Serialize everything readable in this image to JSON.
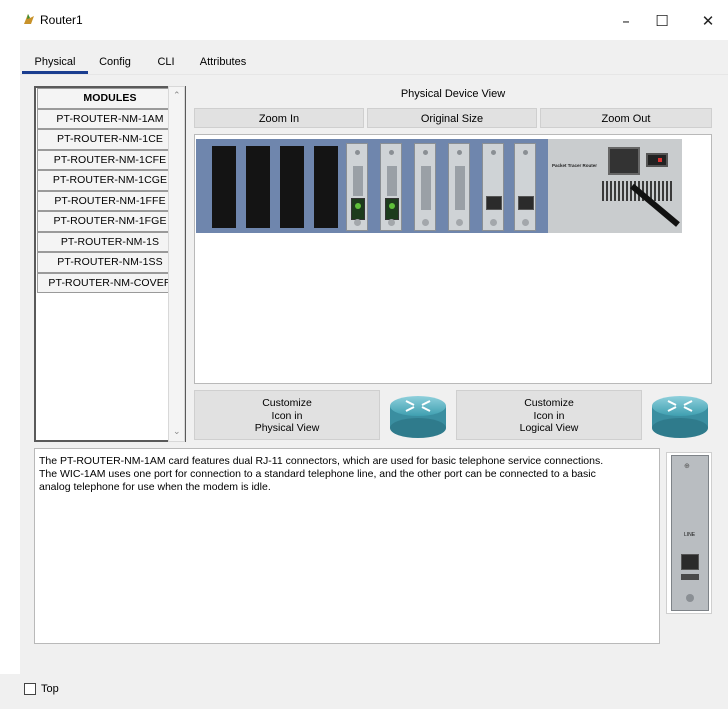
{
  "window": {
    "title": "Router1",
    "minimize": "–",
    "maximize": "☐",
    "close": "✕"
  },
  "tabs": [
    {
      "label": "Physical",
      "active": true
    },
    {
      "label": "Config",
      "active": false
    },
    {
      "label": "CLI",
      "active": false
    },
    {
      "label": "Attributes",
      "active": false
    }
  ],
  "modules": {
    "header": "MODULES",
    "items": [
      "PT-ROUTER-NM-1AM",
      "PT-ROUTER-NM-1CE",
      "PT-ROUTER-NM-1CFE",
      "PT-ROUTER-NM-1CGE",
      "PT-ROUTER-NM-1FFE",
      "PT-ROUTER-NM-1FGE",
      "PT-ROUTER-NM-1S",
      "PT-ROUTER-NM-1SS",
      "PT-ROUTER-NM-COVER"
    ]
  },
  "device_view": {
    "title": "Physical Device View",
    "zoom_in": "Zoom In",
    "original_size": "Original Size",
    "zoom_out": "Zoom Out",
    "psu_label": "Packet Tracer Router"
  },
  "customize": {
    "physical": [
      "Customize",
      "Icon in",
      "Physical View"
    ],
    "logical": [
      "Customize",
      "Icon in",
      "Logical View"
    ]
  },
  "description": {
    "lines": [
      "The PT-ROUTER-NM-1AM card features dual RJ-11 connectors, which are used for basic telephone service connections.",
      "The WIC-1AM uses one port for connection to a standard telephone line, and the other port can be connected to a basic",
      "analog telephone for use when the modem is idle."
    ]
  },
  "preview": {
    "line_label": "LINE"
  },
  "footer": {
    "top_label": "Top"
  },
  "colors": {
    "tab_accent": "#1a3d8f",
    "router_chassis": "#6f86ad",
    "panel_bg": "#f0f0f0"
  }
}
